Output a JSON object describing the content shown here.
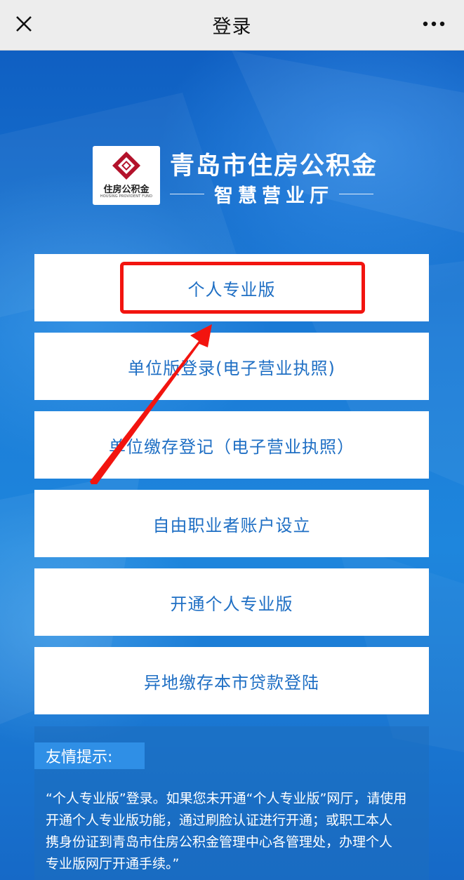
{
  "topbar": {
    "title": "登录",
    "close_icon": "close-icon",
    "more_icon": "more-dots-icon"
  },
  "brand": {
    "logo_cn": "住房公积金",
    "logo_en": "HOUSING PROVIDENT FUND",
    "title": "青岛市住房公积金",
    "subtitle": "智慧营业厅"
  },
  "menu": {
    "items": [
      {
        "label": "个人专业版"
      },
      {
        "label": "单位版登录(电子营业执照)"
      },
      {
        "label": "单位缴存登记（电子营业执照）"
      },
      {
        "label": "自由职业者账户设立"
      },
      {
        "label": "开通个人专业版"
      },
      {
        "label": "异地缴存本市贷款登陆"
      }
    ]
  },
  "tips": {
    "label": "友情提示:",
    "lines": [
      "“个人专业版”登录。如果您未开通“个人专业版”网厅，请使用",
      "开通个人专业版功能，通过刷脸认证进行开通；或职工本人",
      "携身份证到青岛市住房公积金管理中心各管理处，办理个人",
      "专业版网厅开通手续。”"
    ]
  },
  "colors": {
    "accent_text": "#1f6fc4",
    "highlight_red": "#f2140f",
    "logo_red": "#b3122b"
  }
}
